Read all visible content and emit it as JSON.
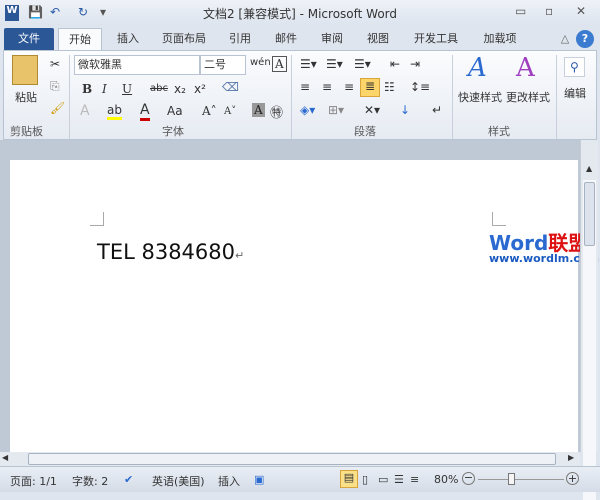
{
  "title": "文档2 [兼容模式] - Microsoft Word",
  "quick_access": {
    "word": "W",
    "save": "💾",
    "undo": "↶",
    "redo": "↻",
    "customize": "▾"
  },
  "window": {
    "minimize": "▭",
    "restore": "▫",
    "close": "✕"
  },
  "tabs": [
    "文件",
    "开始",
    "插入",
    "页面布局",
    "引用",
    "邮件",
    "审阅",
    "视图",
    "开发工具",
    "加载项"
  ],
  "help": "?",
  "collapse": "△",
  "ribbon": {
    "clipboard": {
      "label": "剪贴板",
      "paste": "粘贴"
    },
    "font": {
      "label": "字体",
      "name": "微软雅黑",
      "size": "二号",
      "bold": "B",
      "italic": "I",
      "underline": "U",
      "strike": "abc",
      "sub": "x₂",
      "sup": "x²",
      "grow": "A˄",
      "shrink": "A˅",
      "case": "Aa",
      "color": "A",
      "shade": "A",
      "enclose": "㊕"
    },
    "paragraph": {
      "label": "段落"
    },
    "styles": {
      "label": "样式",
      "quick": "快速样式",
      "change": "更改样式"
    },
    "editing": {
      "label": "编辑"
    }
  },
  "document": {
    "text": "TEL 8384680",
    "para_mark": "↵",
    "watermark_word": "Word",
    "watermark_cn": "联盟",
    "watermark_url": "www.wordlm.com"
  },
  "status": {
    "page": "页面: 1/1",
    "words": "字数: 2",
    "language": "英语(美国)",
    "mode": "插入",
    "zoom": "80%",
    "zoom_percent": 80
  }
}
